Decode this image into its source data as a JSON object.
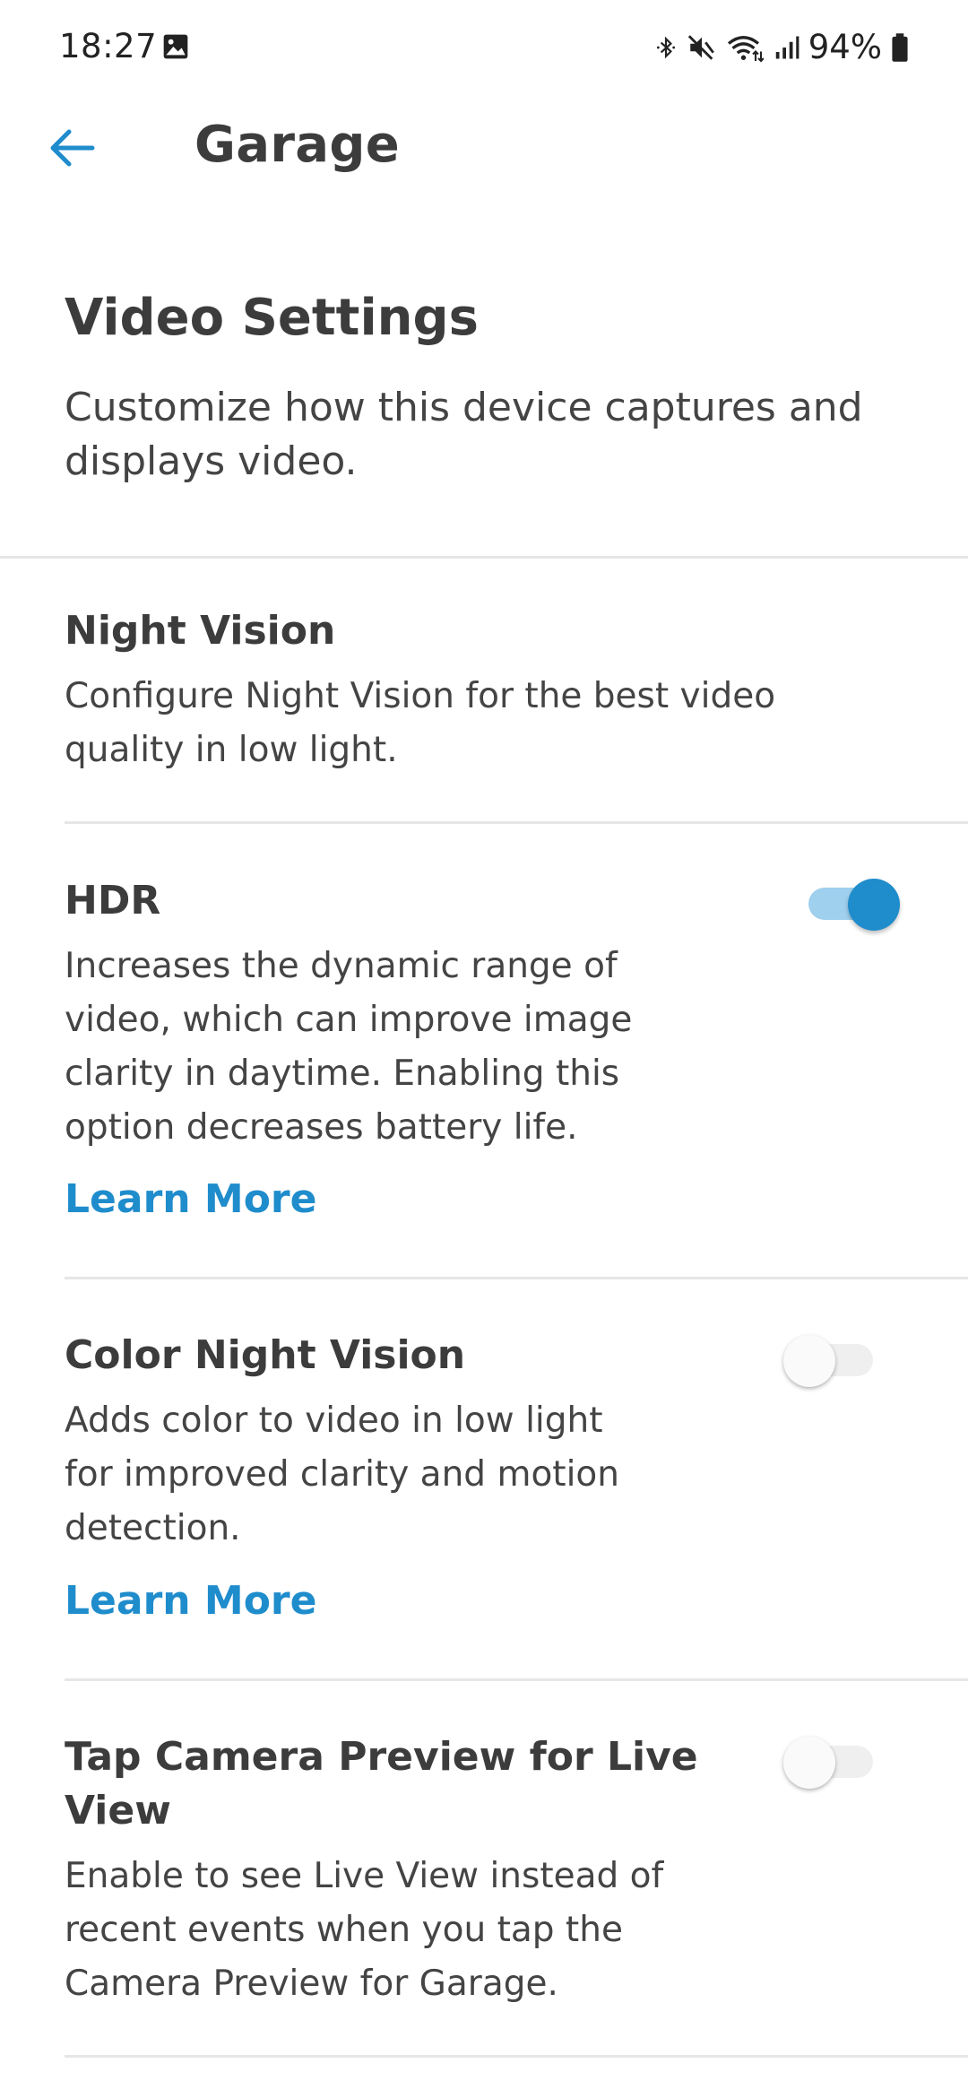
{
  "status_bar": {
    "time": "18:27",
    "battery": "94%",
    "icons": [
      "gallery-icon",
      "bluetooth-icon",
      "mute-icon",
      "wifi-icon",
      "signal-icon",
      "battery-icon"
    ]
  },
  "header": {
    "title": "Garage",
    "back_icon": "back-arrow-icon",
    "accent_color": "#1f8ccc"
  },
  "intro": {
    "title": "Video Settings",
    "description": "Customize how this device captures and displays video."
  },
  "settings": [
    {
      "title": "Night Vision",
      "description": "Configure Night Vision for the best video quality in low light.",
      "has_toggle": false
    },
    {
      "title": "HDR",
      "description": "Increases the dynamic range of video, which can improve image clarity in daytime. Enabling this option decreases battery life.",
      "learn_more": "Learn More",
      "toggle_on": true
    },
    {
      "title": "Color Night Vision",
      "description": "Adds color to video in low light for improved clarity and motion detection.",
      "learn_more": "Learn More",
      "toggle_on": false
    },
    {
      "title": "Tap Camera Preview for Live View",
      "description": "Enable to see Live View instead of recent events when you tap the Camera Preview for Garage.",
      "toggle_on": false
    }
  ]
}
